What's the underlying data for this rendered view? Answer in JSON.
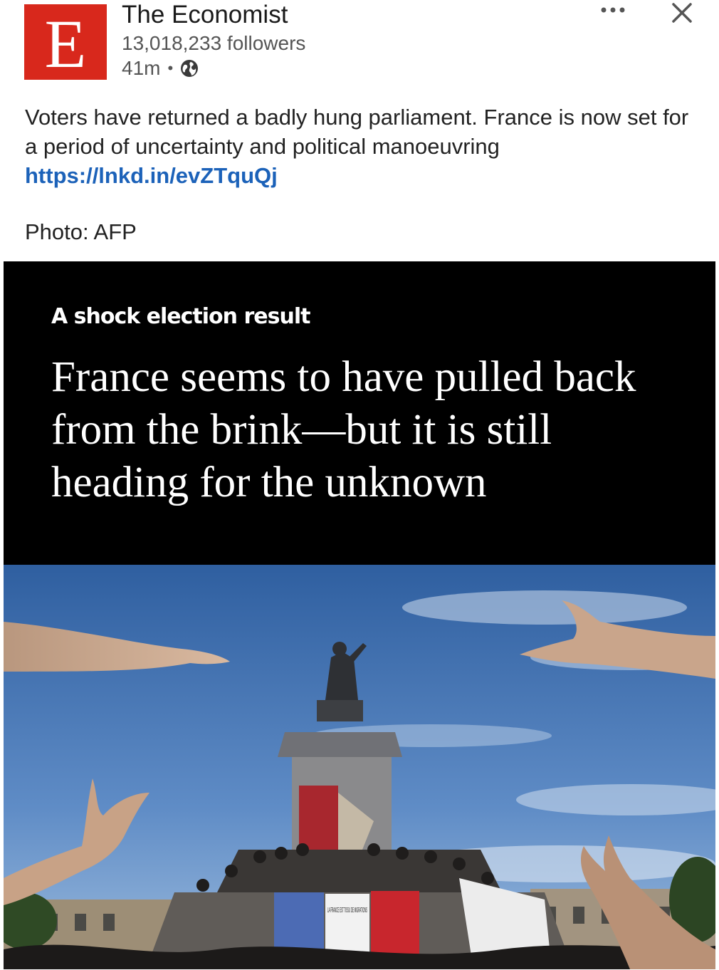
{
  "post": {
    "author": {
      "name": "The Economist",
      "followers": "13,018,233 followers",
      "time": "41m",
      "separator": "•",
      "logo_letter": "E",
      "logo_color": "#d8281c",
      "visibility_icon": "globe-icon"
    },
    "menu_icon": "more-icon",
    "close_icon": "close-icon",
    "text": "Voters have returned a badly hung parliament. France is now set for a period of uncertainty and political manoeuvring",
    "link": "https://lnkd.in/evZTquQj",
    "photo_credit": "Photo: AFP"
  },
  "card": {
    "kicker": "A shock election result",
    "headline": "France seems to have pulled back from the brink—but it is still heading for the unknown",
    "image": {
      "banner_text": "LA FRANCE EST TISSU DE MIGRATIONS"
    }
  },
  "colors": {
    "link": "#1c62b9",
    "card_background": "#000000",
    "sky_top": "#2f5fa0",
    "sky_bottom": "#8fb2d8"
  }
}
